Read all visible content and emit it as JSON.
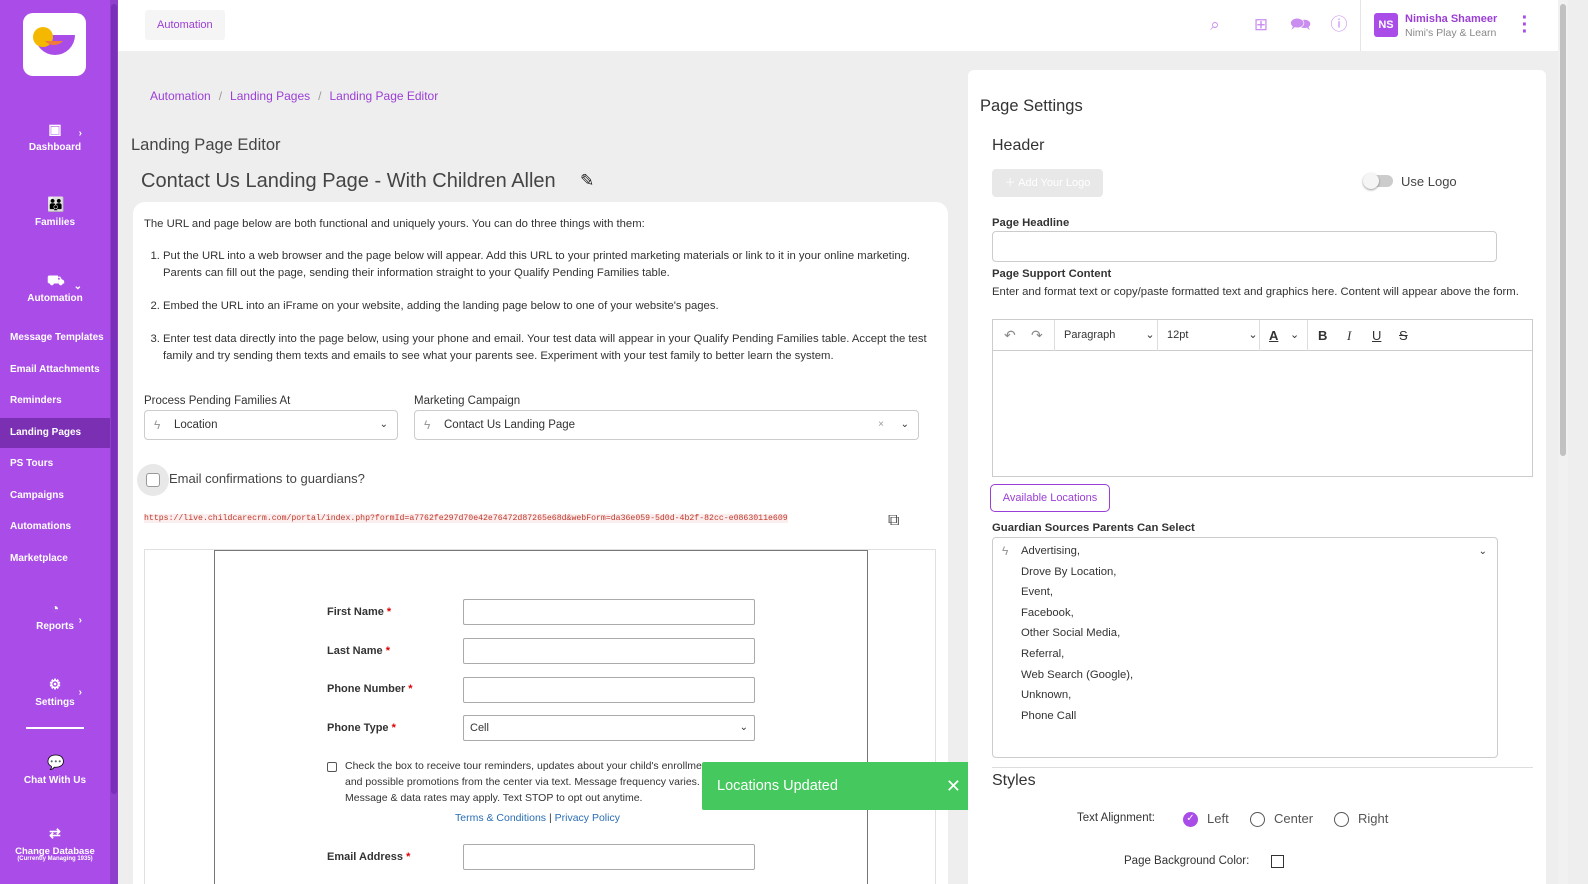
{
  "sidebar": {
    "dashboard": "Dashboard",
    "families": "Families",
    "automation": "Automation",
    "sub_items": [
      "Message Templates",
      "Email Attachments",
      "Reminders",
      "Landing Pages",
      "PS Tours",
      "Campaigns",
      "Automations",
      "Marketplace"
    ],
    "reports": "Reports",
    "settings": "Settings",
    "chat": "Chat With Us",
    "change_db": "Change Database",
    "change_db_sub": "(Currently Managing 1935)"
  },
  "topbar": {
    "tab": "Automation",
    "avatar_initials": "NS",
    "user_name": "Nimisha Shameer",
    "user_org": "Nimi's Play & Learn"
  },
  "breadcrumb": [
    "Automation",
    "Landing Pages",
    "Landing Page Editor"
  ],
  "page_title": "Landing Page Editor",
  "landing_page_name": "Contact Us Landing Page - With Children Allen",
  "intro": "The URL and page below are both functional and uniquely yours. You can do three things with them:",
  "steps": [
    "Put the URL into a web browser and the page below will appear. Add this URL to your printed marketing materials or link to it in your online marketing. Parents can fill out the page, sending their information straight to your Qualify Pending Families table.",
    "Embed the URL into an iFrame on your website, adding the landing page below to one of your website's pages.",
    "Enter test data directly into the page below, using your phone and email. Your test data will appear in your Qualify Pending Families table. Accept the test family and try sending them texts and emails to see what your parents see. Experiment with your test family to better learn the system."
  ],
  "process_label": "Process Pending Families At",
  "process_value": "Location",
  "campaign_label": "Marketing Campaign",
  "campaign_value": "Contact Us Landing Page",
  "email_confirm_label": "Email confirmations to guardians?",
  "url": "https://live.childcarecrm.com/portal/index.php?formId=a7762fe297d70e42e76472d87265e68d&webForm=da36e059-5d0d-4b2f-82cc-e0863011e609",
  "preview_form": {
    "first_name": "First Name",
    "last_name": "Last Name",
    "phone_number": "Phone Number",
    "phone_type": "Phone Type",
    "phone_type_value": "Cell",
    "sms_text": "Check the box to receive tour reminders, updates about your child's enrollment status, and possible promotions from the center via text. Message frequency varies. Message & data rates may apply. Text STOP to opt out anytime.",
    "terms": "Terms & Conditions",
    "privacy": "Privacy Policy",
    "email": "Email Address",
    "required_mark": "*"
  },
  "toast": "Locations Updated",
  "settings": {
    "title": "Page Settings",
    "header": "Header",
    "add_logo": "Add Your Logo",
    "use_logo": "Use Logo",
    "headline_label": "Page Headline",
    "support_label": "Page Support Content",
    "support_help": "Enter and format text or copy/paste formatted text and graphics here. Content will appear above the form.",
    "paragraph": "Paragraph",
    "font_size": "12pt",
    "available_locations": "Available Locations",
    "sources_label": "Guardian Sources Parents Can Select",
    "sources": [
      "Advertising,",
      "Drove By Location,",
      "Event,",
      "Facebook,",
      "Other Social Media,",
      "Referral,",
      "Web Search (Google),",
      "Unknown,",
      "Phone Call"
    ],
    "styles": "Styles",
    "text_alignment": "Text Alignment:",
    "align_left": "Left",
    "align_center": "Center",
    "align_right": "Right",
    "bg_color": "Page Background Color:"
  },
  "colors": {
    "brand": "#a94ce8",
    "toast": "#45c85d",
    "link": "#9b3ed6"
  }
}
